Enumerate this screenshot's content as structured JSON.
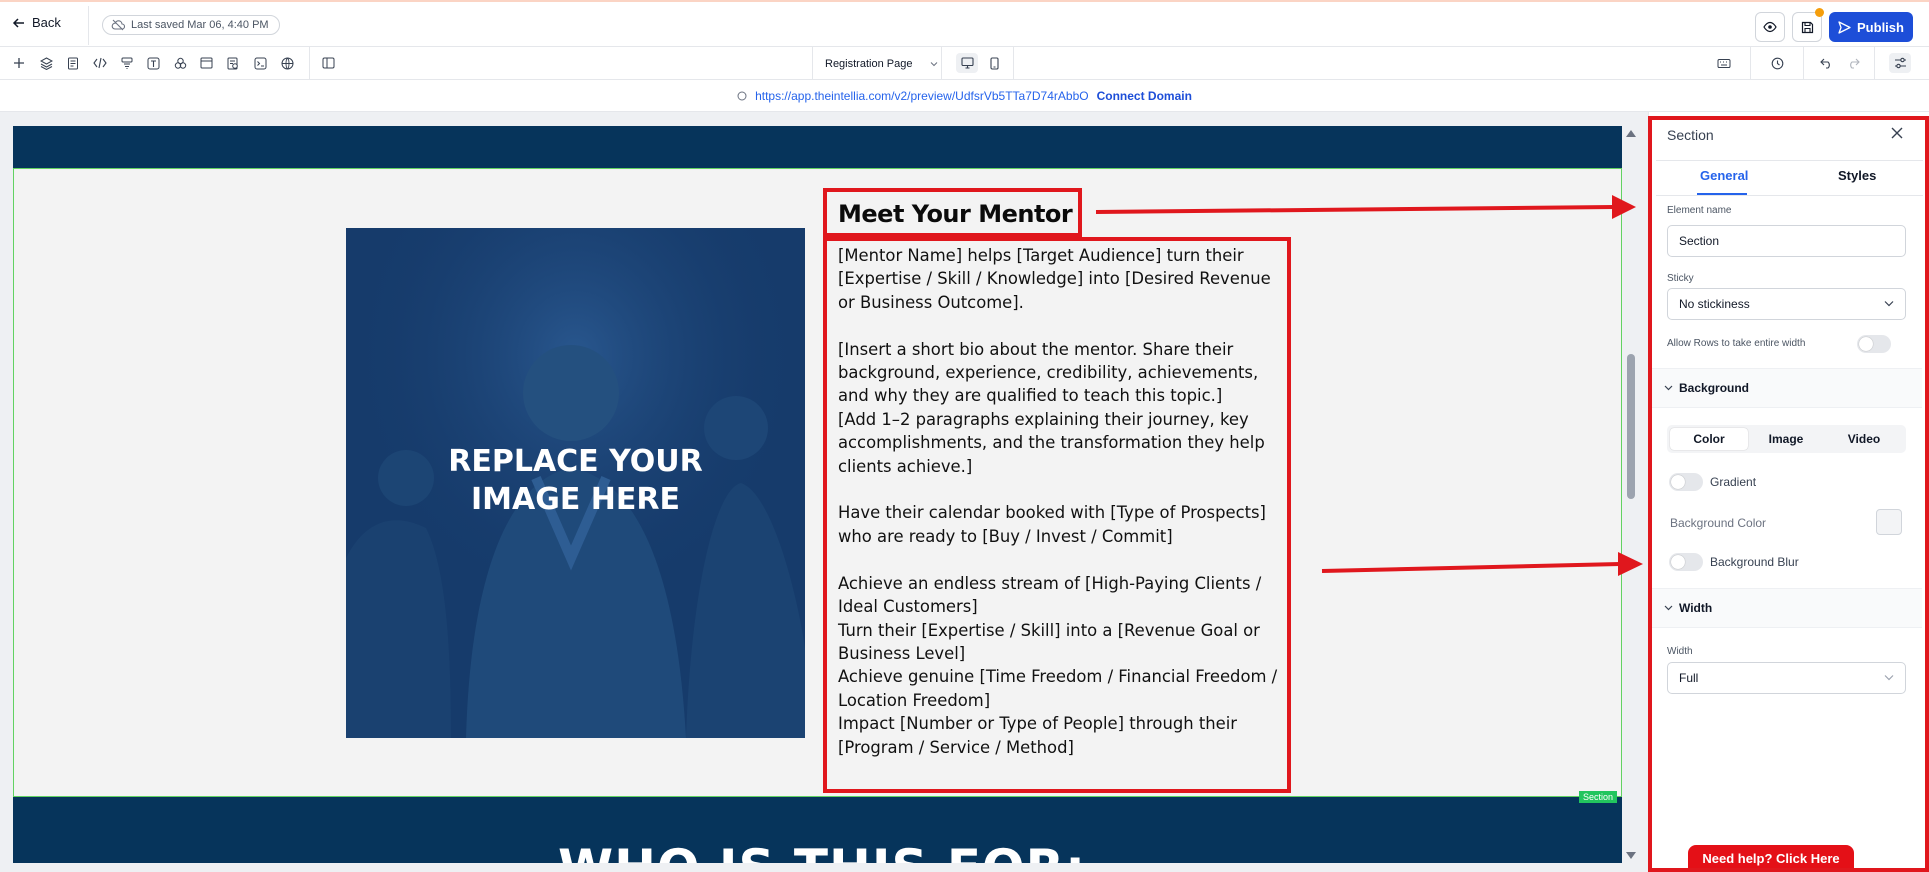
{
  "header": {
    "back_label": "Back",
    "saved_text": "Last saved Mar 06, 4:40 PM",
    "publish_label": "Publish"
  },
  "toolbar": {
    "page_select": "Registration Page",
    "tools": [
      "add-icon",
      "layers-icon",
      "pages-icon",
      "code-icon",
      "forms-icon",
      "text-icon",
      "elements-icon",
      "blocks-icon",
      "surveys-icon",
      "scripts-icon",
      "globe-icon",
      "layout-icon"
    ]
  },
  "urlbar": {
    "url": "https://app.theintellia.com/v2/preview/UdfsrVb5TTa7D74rAbbO",
    "connect_label": "Connect Domain"
  },
  "canvas": {
    "image_placeholder": "REPLACE YOUR\nIMAGE HERE",
    "mentor_heading": "Meet Your Mentor",
    "mentor_body": "[Mentor Name] helps [Target Audience] turn their [Expertise / Skill / Knowledge] into [Desired Revenue or Business Outcome].\n\n[Insert a short bio about the mentor. Share their background, experience, credibility, achievements, and why they are qualified to teach this topic.]\n[Add 1–2 paragraphs explaining their journey, key accomplishments, and the transformation they help clients achieve.]\n\nHave their calendar booked with [Type of Prospects] who are ready to [Buy / Invest / Commit]\n\nAchieve an endless stream of [High-Paying Clients / Ideal Customers]\nTurn their [Expertise / Skill] into a [Revenue Goal or Business Level]\nAchieve genuine [Time Freedom / Financial Freedom / Location Freedom]\nImpact [Number or Type of People] through their [Program / Service / Method]",
    "section_tag": "Section",
    "next_heading": "WHO IS THIS FOR:"
  },
  "panel": {
    "title": "Section",
    "tabs": [
      "General",
      "Styles"
    ],
    "element_name_label": "Element name",
    "element_name_value": "Section",
    "sticky_label": "Sticky",
    "sticky_value": "No stickiness",
    "allow_rows_label": "Allow Rows to take entire width",
    "background_section": "Background",
    "bg_tabs": [
      "Color",
      "Image",
      "Video"
    ],
    "gradient_label": "Gradient",
    "bg_color_label": "Background Color",
    "bg_blur_label": "Background Blur",
    "width_section": "Width",
    "width_label": "Width",
    "width_value": "Full",
    "help_label": "Need help? Click Here"
  },
  "colors": {
    "accent": "#1d4ed8",
    "brand_navy": "#06345b",
    "annotation_red": "#e0171d",
    "selection_green": "#22c55e"
  }
}
